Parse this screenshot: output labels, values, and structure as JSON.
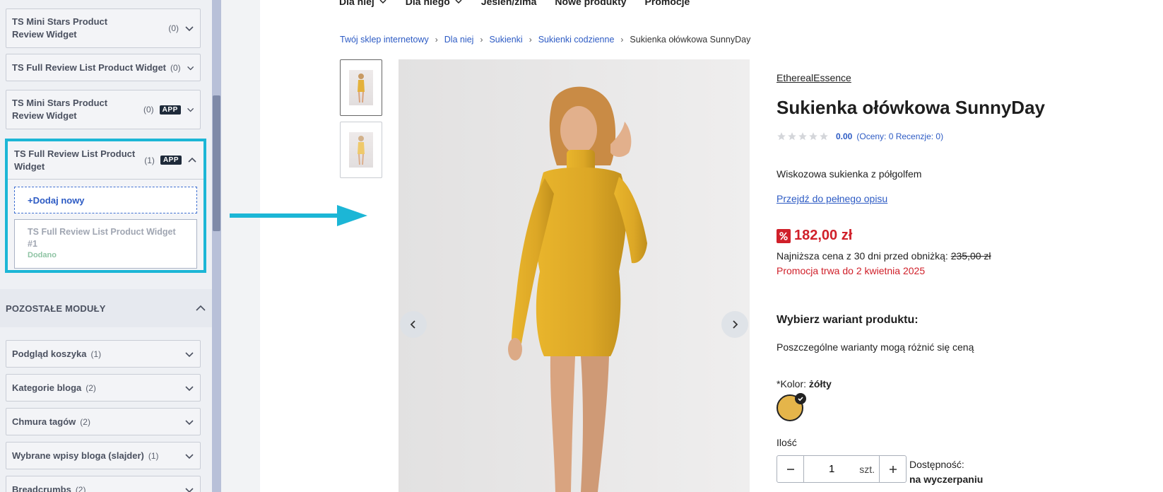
{
  "sidebar": {
    "widgets": [
      {
        "title": "TS Mini Stars Product Review Widget",
        "count": "(0)",
        "badge": ""
      },
      {
        "title": "TS Full Review List Product Widget",
        "count": "(0)",
        "badge": ""
      },
      {
        "title": "TS Mini Stars Product Review Widget",
        "count": "(0)",
        "badge": "APP"
      }
    ],
    "open_widget": {
      "title": "TS Full Review List Product Widget",
      "count": "(1)",
      "badge": "APP",
      "add_new_label": "+Dodaj nowy",
      "item_title": "TS Full Review List Product Widget #1",
      "item_status": "Dodano"
    },
    "section": {
      "title": "POZOSTAŁE MODUŁY"
    },
    "modules": [
      {
        "title": "Podgląd koszyka",
        "count": "(1)"
      },
      {
        "title": "Kategorie bloga",
        "count": "(2)"
      },
      {
        "title": "Chmura tagów",
        "count": "(2)"
      },
      {
        "title": "Wybrane wpisy bloga (slajder)",
        "count": "(1)"
      },
      {
        "title": "Breadcrumbs",
        "count": "(2)"
      }
    ]
  },
  "nav": {
    "items": [
      "Dla niej",
      "Dla niego",
      "Jesień/zima",
      "Nowe produkty",
      "Promocje"
    ]
  },
  "breadcrumb": {
    "items": [
      "Twój sklep internetowy",
      "Dla niej",
      "Sukienki",
      "Sukienki codzienne"
    ],
    "current": "Sukienka ołówkowa SunnyDay"
  },
  "product": {
    "brand": "EtherealEssence",
    "title": "Sukienka ołówkowa SunnyDay",
    "rating": {
      "score": "0.00",
      "reviews": "(Oceny: 0 Recenzje: 0)"
    },
    "short_description": "Wiskozowa sukienka z półgolfem",
    "full_description_link": "Przejdź do pełnego opisu",
    "price": "182,00 zł",
    "lowest_price_label": "Najniższa cena z 30 dni przed obniżką: ",
    "lowest_price_old": "235,00 zł",
    "promo_until": "Promocja trwa do 2 kwietnia 2025",
    "variant_title": "Wybierz wariant produktu:",
    "variant_note": "Poszczególne warianty mogą różnić się ceną",
    "color_label": "*Kolor: ",
    "color_value": "żółty",
    "color_hex": "#e5b54a",
    "qty_label": "Ilość",
    "qty_value": "1",
    "qty_unit": "szt.",
    "availability_label": "Dostępność:",
    "availability_value": "na wyczerpaniu"
  },
  "colors": {
    "accent": "#1cb6d6",
    "link": "#2d5bc4",
    "sale": "#d0202a"
  },
  "icons": [
    "chevron-down-icon",
    "chevron-up-icon",
    "star-icon",
    "percent-icon",
    "check-icon",
    "arrow-left-icon",
    "arrow-right-icon",
    "minus-icon",
    "plus-icon"
  ]
}
